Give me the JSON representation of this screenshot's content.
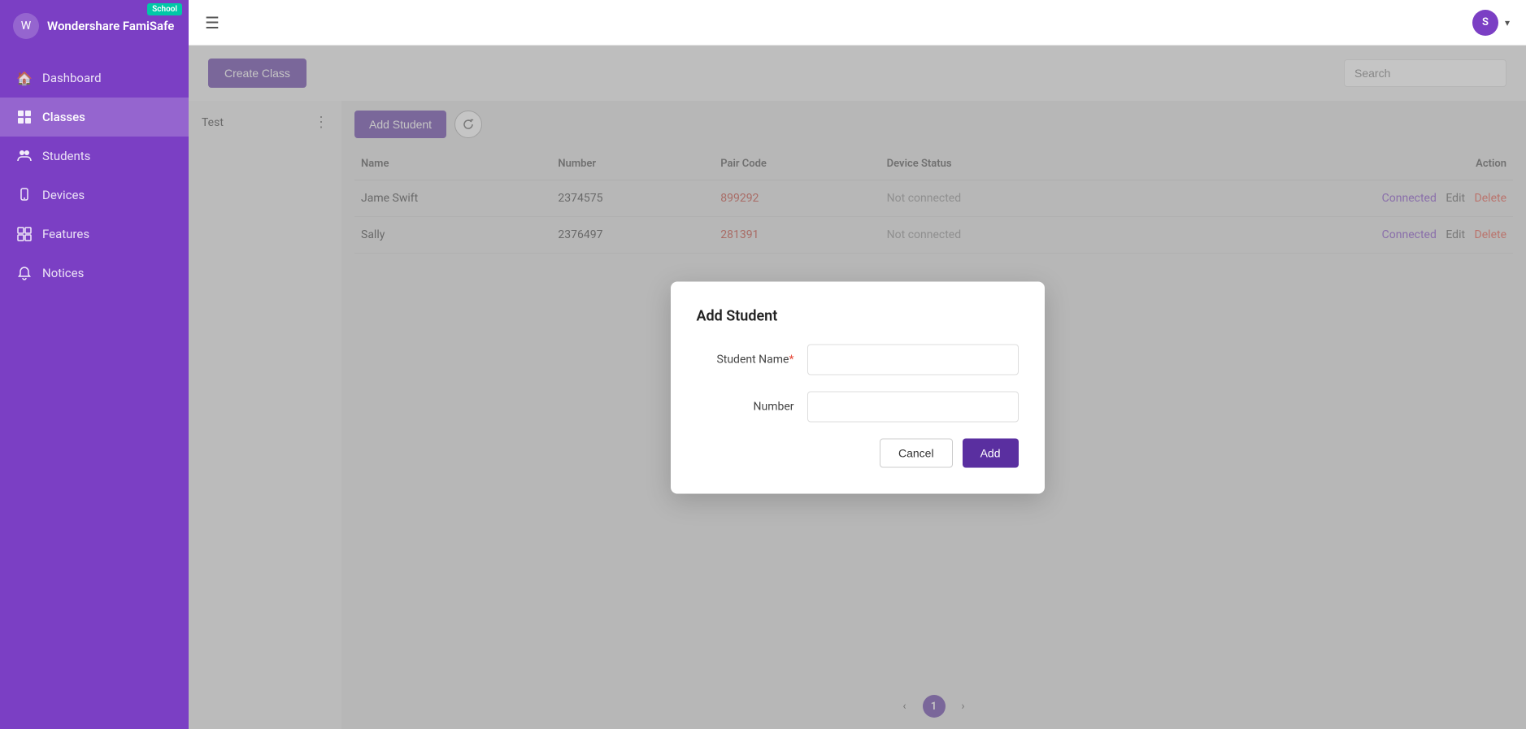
{
  "app": {
    "name": "Wondershare FamiSafe",
    "badge": "School"
  },
  "user": {
    "initial": "S"
  },
  "sidebar": {
    "items": [
      {
        "id": "dashboard",
        "label": "Dashboard",
        "icon": "🏠",
        "active": false
      },
      {
        "id": "classes",
        "label": "Classes",
        "icon": "⊞",
        "active": true
      },
      {
        "id": "students",
        "label": "Students",
        "icon": "👥",
        "active": false
      },
      {
        "id": "devices",
        "label": "Devices",
        "icon": "📱",
        "active": false
      },
      {
        "id": "features",
        "label": "Features",
        "icon": "⊡",
        "active": false
      },
      {
        "id": "notices",
        "label": "Notices",
        "icon": "🔔",
        "active": false
      }
    ]
  },
  "toolbar": {
    "create_class_label": "Create Class",
    "search_placeholder": "Search"
  },
  "class_panel": {
    "current_class": "Test"
  },
  "students_toolbar": {
    "add_student_label": "Add Student"
  },
  "table": {
    "columns": [
      "Name",
      "Number",
      "Pair Code",
      "Device Status",
      "Action"
    ],
    "rows": [
      {
        "name": "Jame Swift",
        "number": "2374575",
        "pair_code": "899292",
        "device_status": "Not connected",
        "actions": [
          "Connected",
          "Edit",
          "Delete"
        ]
      },
      {
        "name": "Sally",
        "number": "2376497",
        "pair_code": "281391",
        "device_status": "Not connected",
        "actions": [
          "Connected",
          "Edit",
          "Delete"
        ]
      }
    ]
  },
  "pagination": {
    "current_page": "1"
  },
  "modal": {
    "title": "Add Student",
    "student_name_label": "Student Name",
    "number_label": "Number",
    "cancel_label": "Cancel",
    "add_label": "Add",
    "required_marker": "*"
  }
}
